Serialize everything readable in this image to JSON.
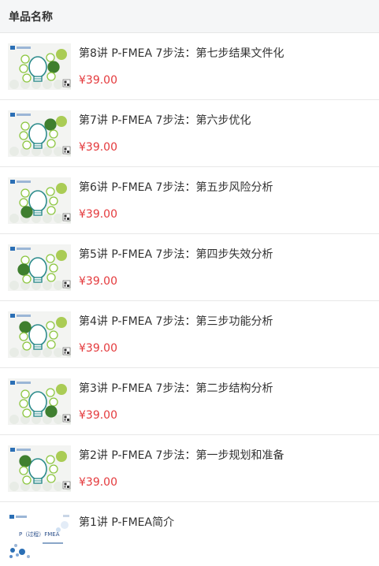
{
  "header": {
    "title": "单品名称"
  },
  "items": [
    {
      "title": "第8讲 P-FMEA 7步法：第七步结果文件化",
      "price": "¥39.00"
    },
    {
      "title": "第7讲 P-FMEA 7步法：第六步优化",
      "price": "¥39.00"
    },
    {
      "title": "第6讲 P-FMEA 7步法：第五步风险分析",
      "price": "¥39.00"
    },
    {
      "title": "第5讲 P-FMEA 7步法：第四步失效分析",
      "price": "¥39.00"
    },
    {
      "title": "第4讲 P-FMEA 7步法：第三步功能分析",
      "price": "¥39.00"
    },
    {
      "title": "第3讲 P-FMEA 7步法：第二步结构分析",
      "price": "¥39.00"
    },
    {
      "title": "第2讲 P-FMEA 7步法：第一步规划和准备",
      "price": "¥39.00"
    },
    {
      "title": "第1讲 P-FMEA简介",
      "price": ""
    }
  ],
  "thumbnail": {
    "kind": "bulb-diagram-icon",
    "colors": {
      "bulb_outline": "#2d8c8c",
      "green_dark": "#3f7f2f",
      "green_light": "#9cc43a",
      "circle_outline": "#8cc63f",
      "logo": "#2b6fb5"
    },
    "intro_text": "P（过程）FMEA"
  }
}
